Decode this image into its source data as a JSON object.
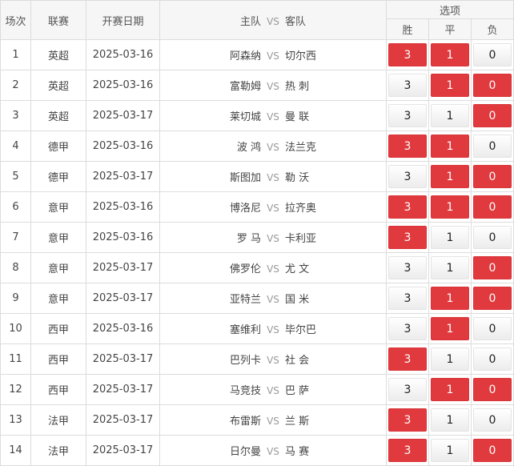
{
  "header": {
    "round": "场次",
    "league": "联赛",
    "date": "开赛日期",
    "home": "主队",
    "vs": "VS",
    "away": "客队",
    "options": "选项",
    "win": "胜",
    "draw": "平",
    "lose": "负"
  },
  "colors": {
    "selected": "#e03a3e",
    "unselected": "#f2f2f2"
  },
  "matches": [
    {
      "no": "1",
      "league": "英超",
      "date": "2025-03-16",
      "home": "阿森纳",
      "vs": "VS",
      "away": "切尔西",
      "w": "3",
      "d": "1",
      "l": "0",
      "ws": true,
      "ds": true,
      "ls": false
    },
    {
      "no": "2",
      "league": "英超",
      "date": "2025-03-16",
      "home": "富勒姆",
      "vs": "VS",
      "away": "热 刺",
      "w": "3",
      "d": "1",
      "l": "0",
      "ws": false,
      "ds": true,
      "ls": true
    },
    {
      "no": "3",
      "league": "英超",
      "date": "2025-03-17",
      "home": "莱切城",
      "vs": "VS",
      "away": "曼 联",
      "w": "3",
      "d": "1",
      "l": "0",
      "ws": false,
      "ds": false,
      "ls": true
    },
    {
      "no": "4",
      "league": "德甲",
      "date": "2025-03-16",
      "home": "波 鸿",
      "vs": "VS",
      "away": "法兰克",
      "w": "3",
      "d": "1",
      "l": "0",
      "ws": true,
      "ds": true,
      "ls": false
    },
    {
      "no": "5",
      "league": "德甲",
      "date": "2025-03-17",
      "home": "斯图加",
      "vs": "VS",
      "away": "勒 沃",
      "w": "3",
      "d": "1",
      "l": "0",
      "ws": false,
      "ds": true,
      "ls": true
    },
    {
      "no": "6",
      "league": "意甲",
      "date": "2025-03-16",
      "home": "博洛尼",
      "vs": "VS",
      "away": "拉齐奥",
      "w": "3",
      "d": "1",
      "l": "0",
      "ws": true,
      "ds": true,
      "ls": true
    },
    {
      "no": "7",
      "league": "意甲",
      "date": "2025-03-16",
      "home": "罗 马",
      "vs": "VS",
      "away": "卡利亚",
      "w": "3",
      "d": "1",
      "l": "0",
      "ws": true,
      "ds": false,
      "ls": false
    },
    {
      "no": "8",
      "league": "意甲",
      "date": "2025-03-17",
      "home": "佛罗伦",
      "vs": "VS",
      "away": "尤 文",
      "w": "3",
      "d": "1",
      "l": "0",
      "ws": false,
      "ds": false,
      "ls": true
    },
    {
      "no": "9",
      "league": "意甲",
      "date": "2025-03-17",
      "home": "亚特兰",
      "vs": "VS",
      "away": "国 米",
      "w": "3",
      "d": "1",
      "l": "0",
      "ws": false,
      "ds": true,
      "ls": true
    },
    {
      "no": "10",
      "league": "西甲",
      "date": "2025-03-16",
      "home": "塞维利",
      "vs": "VS",
      "away": "毕尔巴",
      "w": "3",
      "d": "1",
      "l": "0",
      "ws": false,
      "ds": true,
      "ls": false
    },
    {
      "no": "11",
      "league": "西甲",
      "date": "2025-03-17",
      "home": "巴列卡",
      "vs": "VS",
      "away": "社 会",
      "w": "3",
      "d": "1",
      "l": "0",
      "ws": true,
      "ds": false,
      "ls": false
    },
    {
      "no": "12",
      "league": "西甲",
      "date": "2025-03-17",
      "home": "马竞技",
      "vs": "VS",
      "away": "巴 萨",
      "w": "3",
      "d": "1",
      "l": "0",
      "ws": false,
      "ds": true,
      "ls": true
    },
    {
      "no": "13",
      "league": "法甲",
      "date": "2025-03-17",
      "home": "布雷斯",
      "vs": "VS",
      "away": "兰 斯",
      "w": "3",
      "d": "1",
      "l": "0",
      "ws": true,
      "ds": false,
      "ls": false
    },
    {
      "no": "14",
      "league": "法甲",
      "date": "2025-03-17",
      "home": "日尔曼",
      "vs": "VS",
      "away": "马 赛",
      "w": "3",
      "d": "1",
      "l": "0",
      "ws": true,
      "ds": false,
      "ls": true
    }
  ]
}
